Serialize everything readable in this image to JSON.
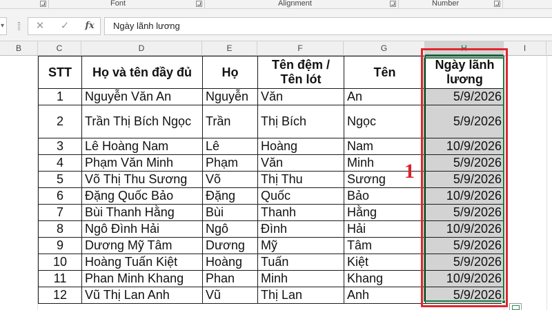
{
  "ribbon": {
    "groups": [
      {
        "label": "Font"
      },
      {
        "label": "Alignment"
      },
      {
        "label": "Number"
      }
    ]
  },
  "formula_bar": {
    "cancel_icon": "close-x",
    "enter_icon": "check",
    "function_label": "fx",
    "value": "Ngày lãnh lương"
  },
  "column_headers": [
    "B",
    "C",
    "D",
    "E",
    "F",
    "G",
    "H",
    "I"
  ],
  "selected_column": "H",
  "table": {
    "headers": [
      "STT",
      "Họ và tên đầy đủ",
      "Họ",
      "Tên đệm / Tên lót",
      "Tên",
      "Ngày lãnh lương"
    ],
    "rows": [
      [
        "1",
        "Nguyễn Văn An",
        "Nguyễn",
        "Văn",
        "An",
        "5/9/2026"
      ],
      [
        "2",
        "Trần Thị Bích Ngọc",
        "Trần",
        "Thị Bích",
        "Ngọc",
        "5/9/2026"
      ],
      [
        "3",
        "Lê Hoàng Nam",
        "Lê",
        "Hoàng",
        "Nam",
        "10/9/2026"
      ],
      [
        "4",
        "Phạm Văn Minh",
        "Phạm",
        "Văn",
        "Minh",
        "5/9/2026"
      ],
      [
        "5",
        "Võ Thị Thu Sương",
        "Võ",
        "Thị Thu",
        "Sương",
        "5/9/2026"
      ],
      [
        "6",
        "Đặng Quốc Bảo",
        "Đặng",
        "Quốc",
        "Bảo",
        "10/9/2026"
      ],
      [
        "7",
        "Bùi Thanh Hằng",
        "Bùi",
        "Thanh",
        "Hằng",
        "5/9/2026"
      ],
      [
        "8",
        "Ngô Đình Hải",
        "Ngô",
        "Đình",
        "Hải",
        "10/9/2026"
      ],
      [
        "9",
        "Dương Mỹ Tâm",
        "Dương",
        "Mỹ",
        "Tâm",
        "5/9/2026"
      ],
      [
        "10",
        "Hoàng Tuấn Kiệt",
        "Hoàng",
        "Tuấn",
        "Kiệt",
        "5/9/2026"
      ],
      [
        "11",
        "Phan Minh Khang",
        "Phan",
        "Minh",
        "Khang",
        "10/9/2026"
      ],
      [
        "12",
        "Vũ Thị Lan Anh",
        "Vũ",
        "Thị Lan",
        "Anh",
        "5/9/2026"
      ]
    ]
  },
  "annotation": {
    "label": "1",
    "color": "#e0262d"
  },
  "colors": {
    "selection": "#217346",
    "highlight_fill": "#d3d3d3",
    "callout_red": "#e0262d"
  }
}
